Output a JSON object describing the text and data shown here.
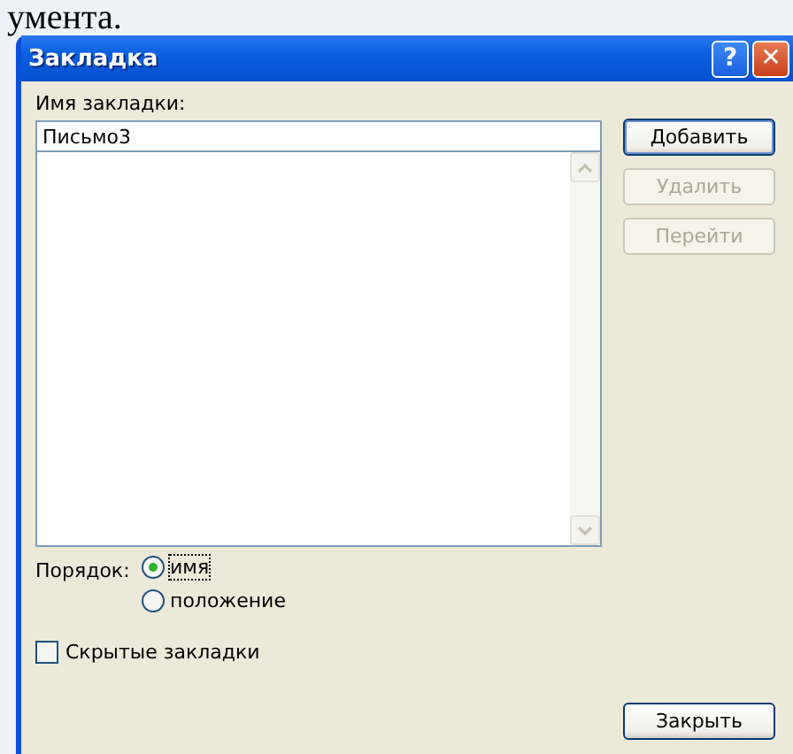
{
  "background_text": "умента.",
  "window": {
    "title": "Закладка",
    "title_buttons": [
      {
        "kind": "help",
        "label": "?"
      },
      {
        "kind": "close",
        "label": "✕"
      }
    ]
  },
  "name_field": {
    "label": "Имя закладки:",
    "value": "Письмо3"
  },
  "buttons": [
    {
      "label": "Добавить",
      "disabled": false,
      "default": true
    },
    {
      "label": "Удалить",
      "disabled": true,
      "default": false
    },
    {
      "label": "Перейти",
      "disabled": true,
      "default": false
    }
  ],
  "sort": {
    "label": "Порядок:",
    "options": [
      {
        "label": "имя",
        "selected": true
      },
      {
        "label": "положение",
        "selected": false
      }
    ]
  },
  "hidden_bookmarks": {
    "label": "Скрытые закладки",
    "checked": false
  },
  "close_button": {
    "label": "Закрыть"
  }
}
